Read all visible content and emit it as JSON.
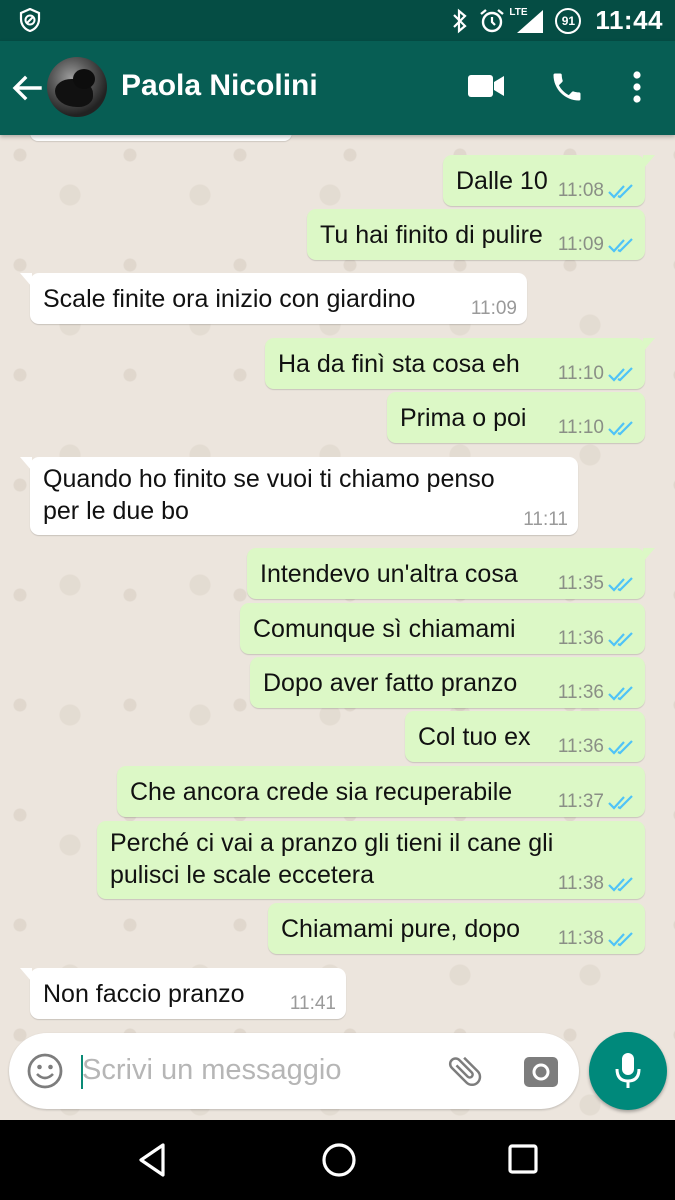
{
  "status_bar": {
    "network": "LTE",
    "battery": "91",
    "time": "11:44"
  },
  "header": {
    "contact_name": "Paola Nicolini"
  },
  "messages": [
    {
      "dir": "out",
      "text": "Dalle 10",
      "time": "11:08",
      "status": "read"
    },
    {
      "dir": "out",
      "text": "Tu hai finito di pulire",
      "time": "11:09",
      "status": "read"
    },
    {
      "dir": "in",
      "text": "Scale finite ora inizio con giardino",
      "time": "11:09"
    },
    {
      "dir": "out",
      "text": "Ha da finì sta cosa eh",
      "time": "11:10",
      "status": "read"
    },
    {
      "dir": "out",
      "text": "Prima o poi",
      "time": "11:10",
      "status": "read"
    },
    {
      "dir": "in",
      "text_lines": [
        "Quando ho finito se vuoi ti chiamo penso",
        "per le due bo"
      ],
      "time": "11:11"
    },
    {
      "dir": "out",
      "text": "Intendevo un'altra cosa",
      "time": "11:35",
      "status": "read"
    },
    {
      "dir": "out",
      "text": "Comunque sì chiamami",
      "time": "11:36",
      "status": "read"
    },
    {
      "dir": "out",
      "text": "Dopo aver fatto pranzo",
      "time": "11:36",
      "status": "read"
    },
    {
      "dir": "out",
      "text": "Col tuo ex",
      "time": "11:36",
      "status": "read"
    },
    {
      "dir": "out",
      "text": "Che ancora crede sia recuperabile",
      "time": "11:37",
      "status": "read"
    },
    {
      "dir": "out",
      "text_lines": [
        "Perché ci vai a pranzo gli tieni il cane gli",
        "pulisci le scale eccetera"
      ],
      "time": "11:38",
      "status": "read"
    },
    {
      "dir": "out",
      "text": "Chiamami pure, dopo",
      "time": "11:38",
      "status": "read"
    },
    {
      "dir": "in",
      "text": "Non faccio pranzo",
      "time": "11:41"
    }
  ],
  "composer": {
    "placeholder": "Scrivi un messaggio"
  },
  "colors": {
    "header": "#075e54",
    "status_bar": "#054d44",
    "outgoing_bubble": "#dcf8c6",
    "incoming_bubble": "#ffffff",
    "read_ticks": "#4fc3f7",
    "mic_button": "#00897b"
  },
  "icons": [
    "shield-icon",
    "bluetooth-icon",
    "alarm-icon",
    "lte-signal-icon",
    "battery-icon",
    "back-arrow-icon",
    "video-call-icon",
    "phone-icon",
    "more-vert-icon",
    "emoji-icon",
    "attach-icon",
    "camera-icon",
    "mic-icon",
    "nav-back-icon",
    "nav-home-icon",
    "nav-recents-icon"
  ]
}
